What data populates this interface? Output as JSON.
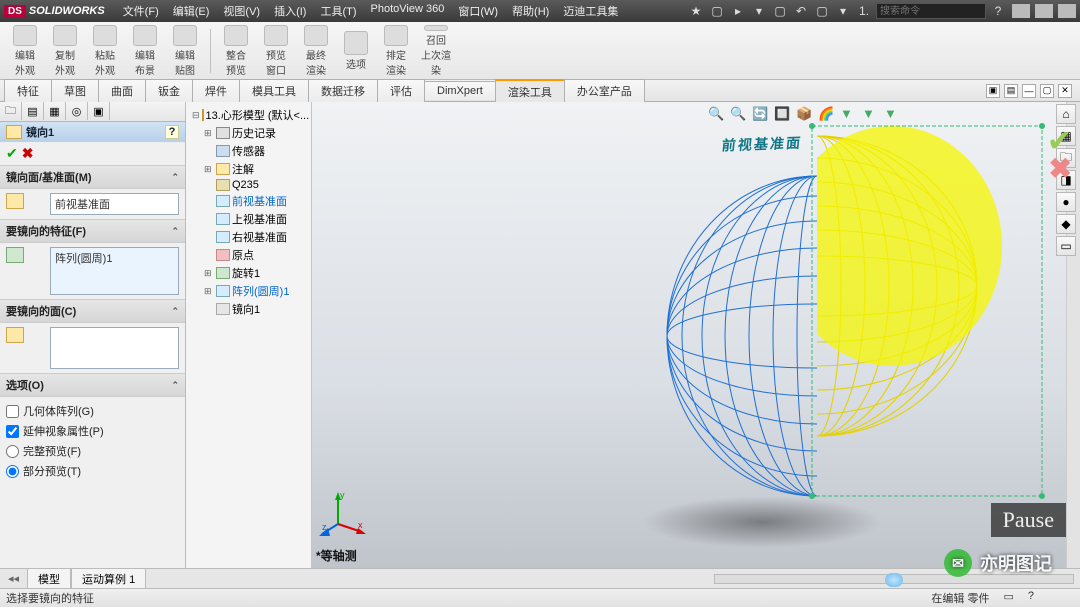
{
  "app": {
    "logo_ds": "DS",
    "logo_text": "SOLIDWORKS"
  },
  "menus": [
    "文件(F)",
    "编辑(E)",
    "视图(V)",
    "插入(I)",
    "工具(T)",
    "PhotoView 360",
    "窗口(W)",
    "帮助(H)",
    "迈迪工具集"
  ],
  "title_right": {
    "search_placeholder": "搜索命令",
    "page": "1."
  },
  "big_items": [
    "编辑外观",
    "复制外观",
    "粘贴外观",
    "编辑布景",
    "编辑贴图",
    "整合预览",
    "预览窗口",
    "最终渲染",
    "选项",
    "排定渲染",
    "召回上次渲染"
  ],
  "tabs": [
    "特征",
    "草图",
    "曲面",
    "钣金",
    "焊件",
    "模具工具",
    "数据迁移",
    "评估",
    "DimXpert",
    "渲染工具",
    "办公室产品"
  ],
  "active_tab": "渲染工具",
  "pm": {
    "title": "镜向1",
    "sec1_title": "镜向面/基准面(M)",
    "sec1_value": "前视基准面",
    "sec2_title": "要镜向的特征(F)",
    "sec2_value": "阵列(圆周)1",
    "sec3_title": "要镜向的面(C)",
    "sec4_title": "选项(O)",
    "opt1": "几何体阵列(G)",
    "opt2": "延伸视象属性(P)",
    "opt3": "完整预览(F)",
    "opt4": "部分预览(T)",
    "q": "?"
  },
  "tree": {
    "root": "13.心形模型  (默认<...",
    "items": [
      {
        "label": "历史记录",
        "cls": "ic-hist",
        "tw": "⊞"
      },
      {
        "label": "传感器",
        "cls": "ic-sens",
        "tw": ""
      },
      {
        "label": "注解",
        "cls": "ic-ann",
        "tw": "⊞"
      },
      {
        "label": "Q235",
        "cls": "ic-mat",
        "tw": ""
      },
      {
        "label": "前视基准面",
        "cls": "ic-plane",
        "tw": "",
        "sel": true
      },
      {
        "label": "上视基准面",
        "cls": "ic-plane",
        "tw": ""
      },
      {
        "label": "右视基准面",
        "cls": "ic-plane",
        "tw": ""
      },
      {
        "label": "原点",
        "cls": "ic-orig",
        "tw": ""
      },
      {
        "label": "旋转1",
        "cls": "ic-rev",
        "tw": "⊞"
      },
      {
        "label": "阵列(圆周)1",
        "cls": "ic-patt",
        "tw": "⊞",
        "sel": true
      },
      {
        "label": "镜向1",
        "cls": "ic-mir",
        "tw": ""
      }
    ]
  },
  "hud_icons": [
    "🔍",
    "🔍",
    "🔄",
    "🔲",
    "📦",
    "🌈",
    "▼",
    "▼",
    "▼"
  ],
  "label3d": "前视基准面",
  "triad": {
    "x": "x",
    "y": "y",
    "z": "z"
  },
  "view_label": "*等轴测",
  "bottom_tabs": [
    "模型",
    "运动算例 1"
  ],
  "status": {
    "left": "选择要镜向的特征",
    "mode": "在编辑 零件"
  },
  "pause": "Pause",
  "watermark": "亦明图记"
}
